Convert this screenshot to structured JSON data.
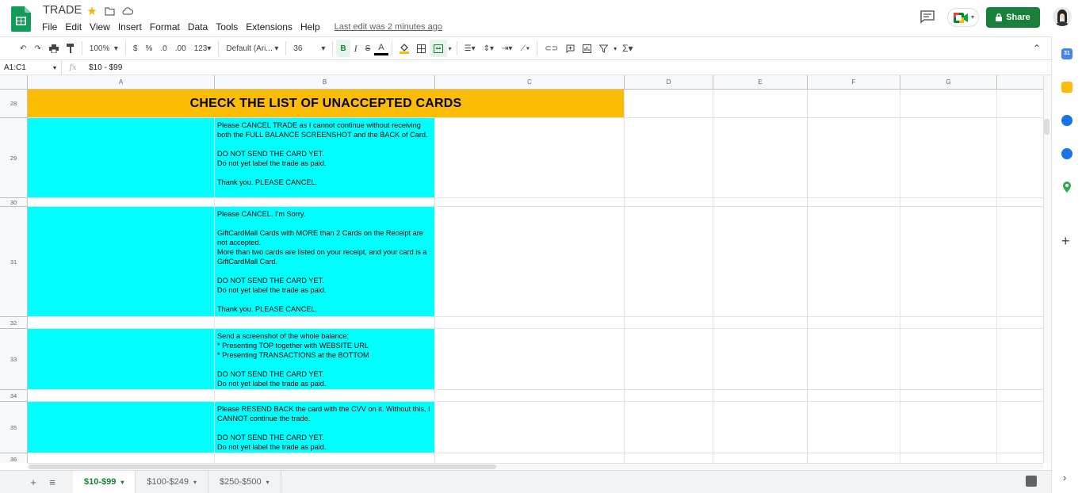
{
  "app": {
    "title": "TRADE",
    "last_edit": "Last edit was 2 minutes ago",
    "share_label": "Share"
  },
  "menu": [
    "File",
    "Edit",
    "View",
    "Insert",
    "Format",
    "Data",
    "Tools",
    "Extensions",
    "Help"
  ],
  "toolbar": {
    "zoom": "100%",
    "currency": "$",
    "percent": "%",
    "dec_minus": ".0",
    "dec_plus": ".00",
    "more_formats": "123",
    "font": "Default (Ari...",
    "font_size": "36"
  },
  "formula_bar": {
    "name_box": "A1:C1",
    "fx": "fx",
    "content": "$10 - $99"
  },
  "columns": [
    "A",
    "B",
    "C",
    "D",
    "E",
    "F",
    "G"
  ],
  "rows": [
    "28",
    "29",
    "30",
    "31",
    "32",
    "33",
    "34",
    "35",
    "36"
  ],
  "banner": "CHECK THE LIST OF UNACCEPTED CARDS",
  "notes": {
    "r29": "Please CANCEL TRADE as I cannot continue without receiving both the FULL BALANCE SCREENSHOT and the BACK of Card.\n\nDO NOT SEND THE CARD YET.\nDo not yet label the trade as paid.\n\nThank you. PLEASE CANCEL.",
    "r31": "Please CANCEL. I'm Sorry.\n\nGiftCardMall Cards with MORE than 2 Cards on the Receipt are not accepted.\nMore than two cards are listed on your receipt, and your card is a GiftCardMall Card.\n\nDO NOT SEND THE CARD YET.\nDo not yet label the trade as paid.\n\nThank you. PLEASE CANCEL.",
    "r33": "Send a screenshot of the whole balance:\n* Presenting TOP together with WEBSITE URL\n* Presenting TRANSACTIONS at the BOTTOM\n\nDO NOT SEND THE CARD YET.\nDo not yet label the trade as paid.",
    "r35": "Please RESEND BACK the card with the CVV on it. Without this, I CANNOT continue the trade.\n\nDO NOT SEND THE CARD YET.\nDo not yet label the trade as paid."
  },
  "sheets": [
    "$10-$99",
    "$100-$249",
    "$250-$500"
  ],
  "colors": {
    "accent": "#188038",
    "banner": "#fbbc04",
    "note_fill": "#00ffff"
  }
}
